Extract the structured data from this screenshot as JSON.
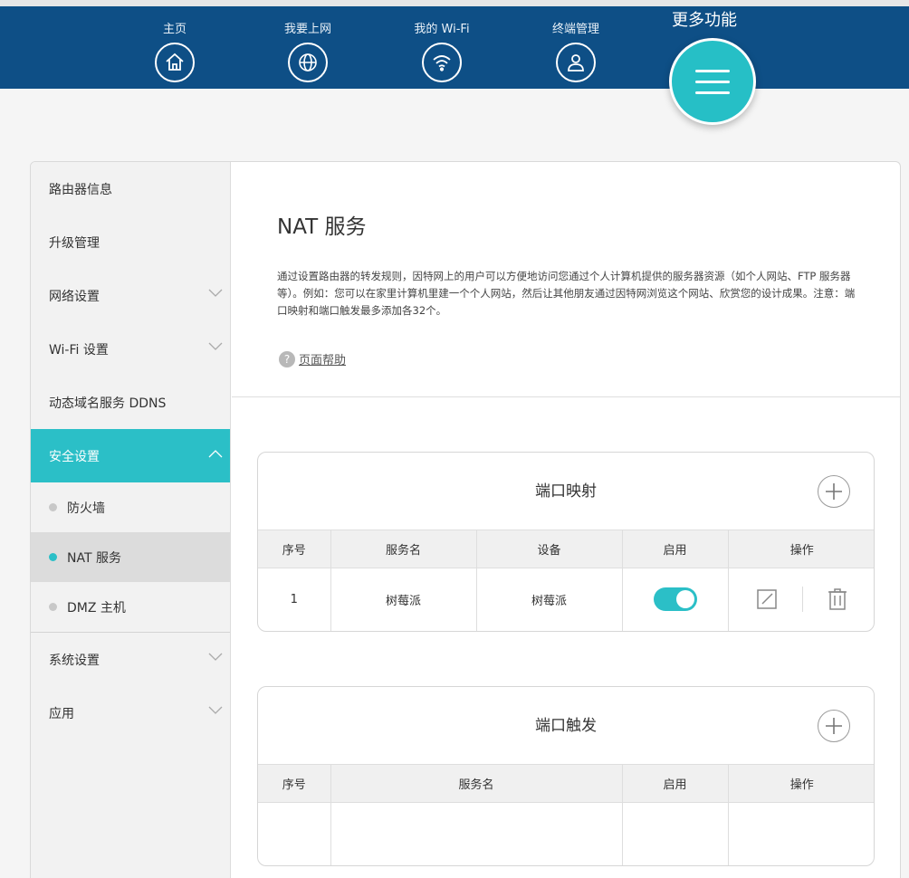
{
  "nav": {
    "items": [
      {
        "label": "主页",
        "icon": "home-icon"
      },
      {
        "label": "我要上网",
        "icon": "globe-icon"
      },
      {
        "label": "我的 Wi-Fi",
        "icon": "wifi-icon"
      },
      {
        "label": "终端管理",
        "icon": "user-icon"
      }
    ],
    "more_label": "更多功能"
  },
  "sidebar": {
    "items": [
      {
        "label": "路由器信息"
      },
      {
        "label": "升级管理"
      },
      {
        "label": "网络设置"
      },
      {
        "label": "Wi-Fi 设置"
      },
      {
        "label": "动态域名服务 DDNS"
      },
      {
        "label": "安全设置"
      },
      {
        "label": "系统设置"
      },
      {
        "label": "应用"
      }
    ],
    "sub_items": [
      {
        "label": "防火墙"
      },
      {
        "label": "NAT 服务"
      },
      {
        "label": "DMZ 主机"
      }
    ]
  },
  "page": {
    "title": "NAT 服务",
    "description": "通过设置路由器的转发规则，因特网上的用户可以方便地访问您通过个人计算机提供的服务器资源（如个人网站、FTP 服务器等）。例如：您可以在家里计算机里建一个个人网站，然后让其他朋友通过因特网浏览这个网站、欣赏您的设计成果。注意：端口映射和端口触发最多添加各32个。",
    "help_icon": "?",
    "help_label": "页面帮助"
  },
  "port_mapping": {
    "title": "端口映射",
    "columns": [
      "序号",
      "服务名",
      "设备",
      "启用",
      "操作"
    ],
    "rows": [
      {
        "index": "1",
        "service": "树莓派",
        "device": "树莓派",
        "enabled": true
      }
    ]
  },
  "port_trigger": {
    "title": "端口触发",
    "columns": [
      "序号",
      "服务名",
      "启用",
      "操作"
    ]
  },
  "colors": {
    "header_bg": "#0e4f86",
    "accent": "#2bbfc7"
  }
}
